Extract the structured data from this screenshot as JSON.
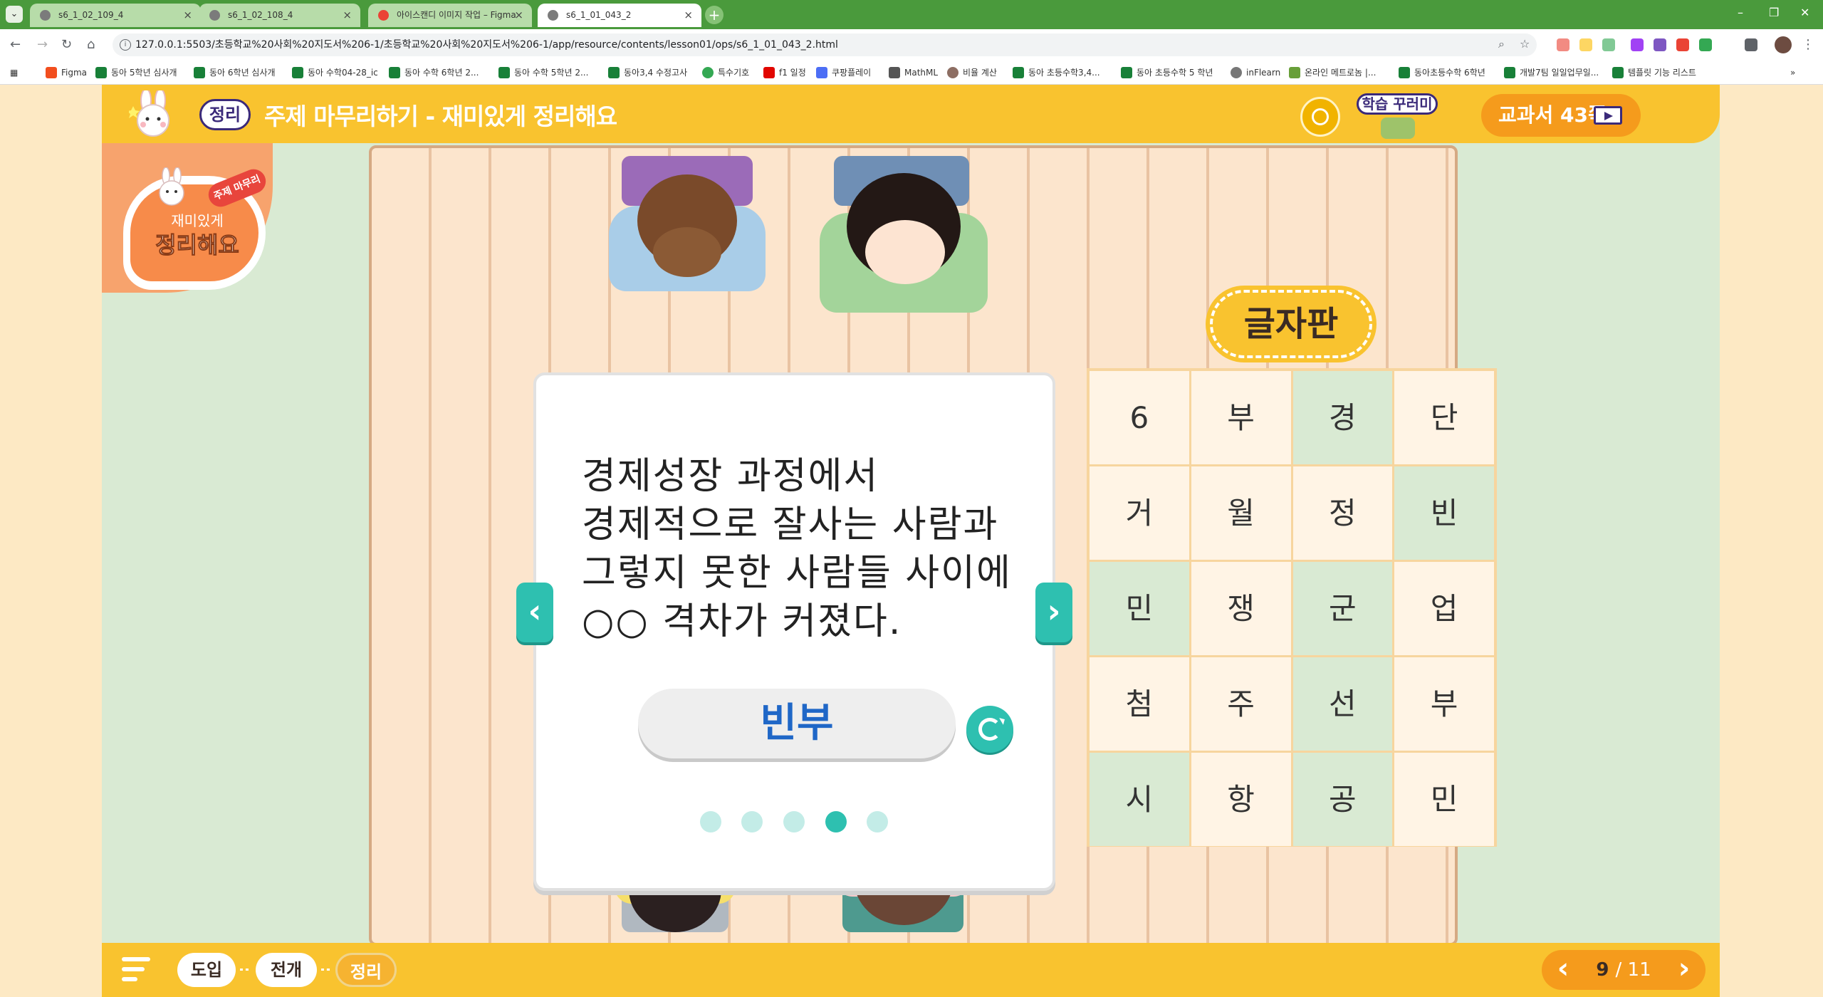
{
  "browser": {
    "tabs": [
      {
        "title": "s6_1_02_109_4",
        "active": false
      },
      {
        "title": "s6_1_02_108_4",
        "active": false
      },
      {
        "title": "아이스캔디 이미지 작업 – Figma",
        "active": false
      },
      {
        "title": "s6_1_01_043_2",
        "active": true
      }
    ],
    "url": "127.0.0.1:5503/초등학교%20사회%20지도서%206-1/초등학교%20사회%20지도서%206-1/app/resource/contents/lesson01/ops/s6_1_01_043_2.html",
    "bookmarks": [
      "Figma",
      "동아 5학년 심사개",
      "동아 6학년 심사개",
      "동아 수학04-28_ic",
      "동아 수학 6학년 2...",
      "동아 수학 5학년 2...",
      "동아3,4 수정고사",
      "특수기호",
      "f1 일정",
      "쿠팡플레이",
      "MathML",
      "비율 계산",
      "동아 초등수학3,4...",
      "동아 초등수학 5 학년",
      "inFlearn",
      "온라인 메트로놈 |...",
      "동아초등수학 6학년",
      "개발7팀 일일업무일...",
      "템플릿 기능 리스트"
    ]
  },
  "header": {
    "badge": "정리",
    "title": "주제 마무리하기 - 재미있게 정리해요",
    "bundle_label": "학습 꾸러미",
    "textbook_label": "교과서 43쪽"
  },
  "sticker": {
    "tag": "주제 마무리",
    "top": "재미있게",
    "main": "정리해요"
  },
  "quiz": {
    "question": "경제성장 과정에서 경제적으로 잘사는 사람과 그렇지 못한 사람들 사이에 ○○ 격차가 커졌다.",
    "answer": "빈부",
    "dots_total": 5,
    "dots_active_index": 3
  },
  "letter_board": {
    "title": "글자판",
    "rows": [
      [
        "6",
        "부",
        "경",
        "단"
      ],
      [
        "거",
        "월",
        "정",
        "빈"
      ],
      [
        "민",
        "쟁",
        "군",
        "업"
      ],
      [
        "첨",
        "주",
        "선",
        "부"
      ],
      [
        "시",
        "항",
        "공",
        "민"
      ]
    ],
    "highlight": [
      [
        false,
        false,
        true,
        false
      ],
      [
        false,
        false,
        false,
        true
      ],
      [
        true,
        false,
        true,
        false
      ],
      [
        false,
        false,
        true,
        false
      ],
      [
        true,
        false,
        true,
        false
      ]
    ]
  },
  "footer": {
    "steps": [
      "도입",
      "전개",
      "정리"
    ],
    "current_step": 2,
    "page_current": "9",
    "page_total": "/ 11"
  },
  "colors": {
    "header_yellow": "#f9c32f",
    "accent_teal": "#2ec0b0",
    "textbook_orange": "#f59b1c",
    "answer_blue": "#1f67c7",
    "stage_green": "#d9ead3"
  }
}
